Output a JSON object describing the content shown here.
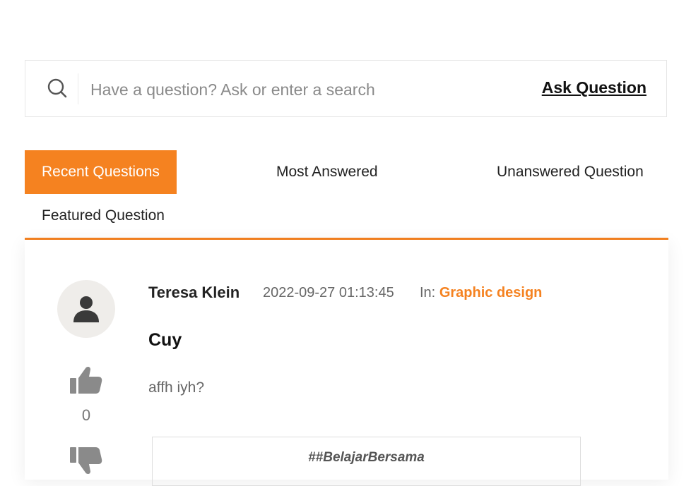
{
  "search": {
    "placeholder": "Have a question? Ask or enter a search",
    "ask_label": "Ask Question",
    "icon": "search-icon"
  },
  "tabs": [
    {
      "label": "Recent Questions",
      "active": true
    },
    {
      "label": "Most Answered",
      "active": false
    },
    {
      "label": "Unanswered Question",
      "active": false
    },
    {
      "label": "Featured Question",
      "active": false
    }
  ],
  "colors": {
    "accent": "#f58220"
  },
  "question": {
    "author": "Teresa Klein",
    "timestamp": "2022-09-27 01:13:45",
    "in_label": "In:",
    "category": "Graphic design",
    "title": "Cuy",
    "body": "affh iyh?",
    "votes": "0",
    "tag_text": "##BelajarBersama",
    "icons": {
      "avatar": "user-avatar-icon",
      "upvote": "thumbs-up-icon",
      "downvote": "thumbs-down-icon"
    }
  }
}
